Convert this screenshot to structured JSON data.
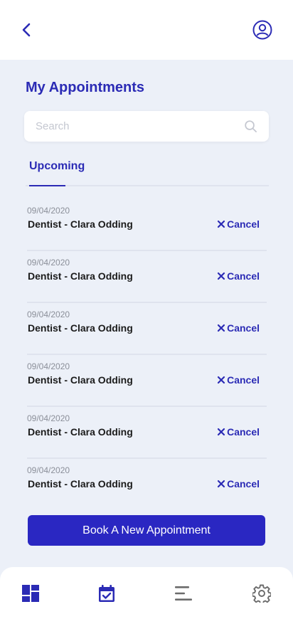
{
  "header": {
    "back_icon": "chevron-left-icon",
    "profile_icon": "user-circle-icon"
  },
  "page": {
    "title": "My Appointments"
  },
  "search": {
    "placeholder": "Search",
    "value": ""
  },
  "tabs": [
    {
      "label": "Upcoming",
      "active": true
    }
  ],
  "appointments": [
    {
      "date": "09/04/2020",
      "title": "Dentist - Clara Odding",
      "action": "Cancel"
    },
    {
      "date": "09/04/2020",
      "title": "Dentist - Clara Odding",
      "action": "Cancel"
    },
    {
      "date": "09/04/2020",
      "title": "Dentist - Clara Odding",
      "action": "Cancel"
    },
    {
      "date": "09/04/2020",
      "title": "Dentist - Clara Odding",
      "action": "Cancel"
    },
    {
      "date": "09/04/2020",
      "title": "Dentist - Clara Odding",
      "action": "Cancel"
    },
    {
      "date": "09/04/2020",
      "title": "Dentist - Clara Odding",
      "action": "Cancel"
    }
  ],
  "book_button": {
    "label": "Book A New Appointment"
  },
  "bottom_nav": [
    {
      "icon": "dashboard-icon",
      "active": true
    },
    {
      "icon": "calendar-check-icon",
      "active": true
    },
    {
      "icon": "menu-lines-icon",
      "active": false
    },
    {
      "icon": "settings-gear-icon",
      "active": false
    }
  ],
  "colors": {
    "accent": "#2b2bb5",
    "button": "#2a27c2",
    "background": "#ecf0f8",
    "inactive_icon": "#6b6b6b"
  }
}
